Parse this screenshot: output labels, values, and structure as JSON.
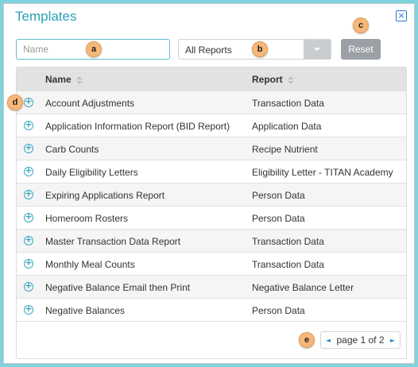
{
  "dialog": {
    "title": "Templates",
    "close_icon": "×"
  },
  "filters": {
    "name_placeholder": "Name",
    "name_value": "",
    "report_select_value": "All Reports",
    "reset_label": "Reset"
  },
  "annotations": {
    "a": "a",
    "b": "b",
    "c": "c",
    "d": "d",
    "e": "e"
  },
  "table": {
    "columns": [
      "Name",
      "Report"
    ],
    "rows": [
      {
        "name": "Account Adjustments",
        "report": "Transaction Data"
      },
      {
        "name": "Application Information Report (BID Report)",
        "report": "Application Data"
      },
      {
        "name": "Carb Counts",
        "report": "Recipe Nutrient"
      },
      {
        "name": "Daily Eligibility Letters",
        "report": "Eligibility Letter - TITAN Academy"
      },
      {
        "name": "Expiring Applications Report",
        "report": "Person Data"
      },
      {
        "name": "Homeroom Rosters",
        "report": "Person Data"
      },
      {
        "name": "Master Transaction Data Report",
        "report": "Transaction Data"
      },
      {
        "name": "Monthly Meal Counts",
        "report": "Transaction Data"
      },
      {
        "name": "Negative Balance Email then Print",
        "report": "Negative Balance Letter"
      },
      {
        "name": "Negative Balances",
        "report": "Person Data"
      }
    ]
  },
  "pagination": {
    "label": "page 1 of 2",
    "prev_icon": "◄",
    "next_icon": "►"
  },
  "colors": {
    "accent": "#28a3b5",
    "header_bg": "#e2e2e2",
    "badge": "#f6b87a",
    "reset_bg": "#9aa0a5"
  }
}
